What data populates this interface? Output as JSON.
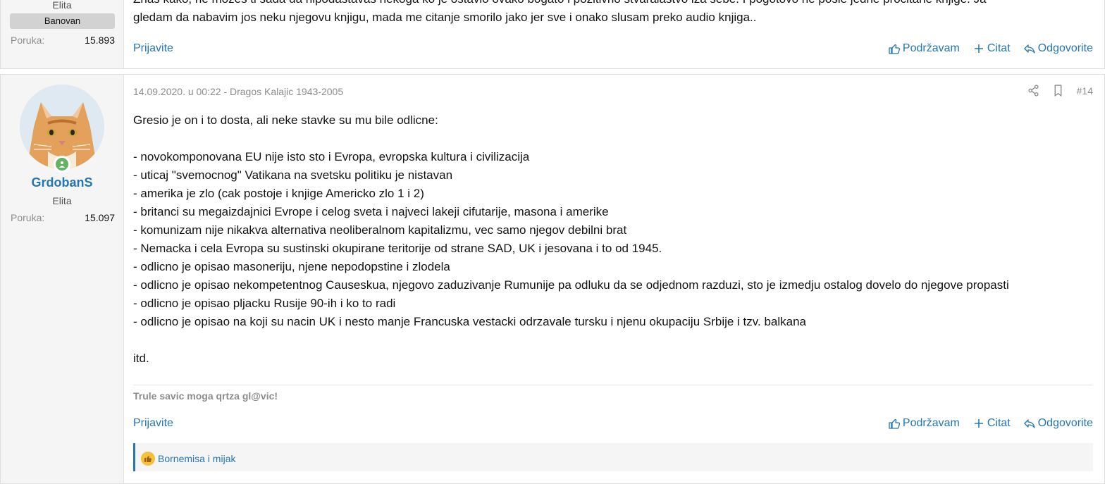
{
  "post1": {
    "user_title": "Elita",
    "banner": "Banovan",
    "stat_label": "Poruka:",
    "stat_value": "15.893",
    "text_line1": "Znas kako, ne mozes ti sada da nipodastavas nekoga ko je ostavio ovako bogato i pozitivno stvaralastvo iza sebe. I pogotovo ne posle jedne procitane knjige. Ja",
    "text_line2": "gledam da nabavim jos neku njegovu knjigu, mada me citanje smorilo jako jer sve i onako slusam preko audio knjiga..",
    "report": "Prijavite",
    "like": "Podržavam",
    "quote": "Citat",
    "reply": "Odgovorite"
  },
  "post2": {
    "username": "GrdobanS",
    "user_title": "Elita",
    "stat_label": "Poruka:",
    "stat_value": "15.097",
    "meta": "14.09.2020. u 00:22 - Dragos Kalajic 1943-2005",
    "post_number": "#14",
    "lines": [
      "Gresio je on i to dosta, ali neke stavke su mu bile odlicne:",
      "",
      "- novokomponovana EU nije isto sto i Evropa, evropska kultura i civilizacija",
      "- uticaj \"svemocnog\" Vatikana na svetsku politiku je nistavan",
      "- amerika je zlo (cak postoje i knjige Americko zlo 1 i 2)",
      "- britanci su megaizdajnici Evrope i celog sveta i najveci lakeji cifutarije, masona i amerike",
      "- komunizam nije nikakva alternativa neoliberalnom kapitalizmu, vec samo njegov debilni brat",
      "- Nemacka i cela Evropa su sustinski okupirane teritorije od strane SAD, UK i jesovana i to od 1945.",
      "- odlicno je opisao masoneriju, njene nepodopstine i zlodela",
      "- odlicno je opisao nekompetentnog Causeskua, njegovo zaduzivanje Rumunije pa odluku da se odjednom razduzi, sto je izmedju ostalog dovelo do njegove propasti",
      "- odlicno je opisao pljacku Rusije 90-ih i ko to radi",
      "- odlicno je opisao na koji su nacin UK i nesto manje Francuska vestacki odrzavale tursku i njenu okupaciju Srbije i tzv. balkana",
      "",
      "itd."
    ],
    "signature": "Trule savic moga qrtza gl@vic!",
    "report": "Prijavite",
    "like": "Podržavam",
    "quote": "Citat",
    "reply": "Odgovorite",
    "reactions": "Bornemisa i mijak"
  },
  "icons": {
    "like": "thumbs-up-icon",
    "quote": "plus-icon",
    "reply": "reply-icon",
    "share": "share-icon",
    "bookmark": "bookmark-icon",
    "online": "online-user-icon"
  },
  "colors": {
    "link": "#2577b1",
    "muted": "#8c8c8c",
    "online": "#63b265"
  }
}
